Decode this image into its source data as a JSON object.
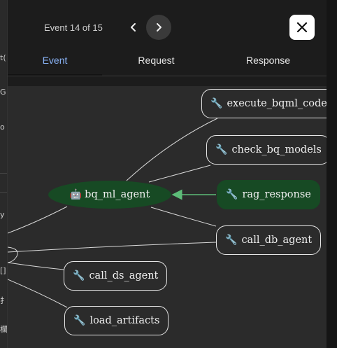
{
  "header": {
    "counter": "Event 14 of 15",
    "prev_icon": "chevron-left-icon",
    "next_icon": "chevron-right-icon",
    "close_icon": "close-icon"
  },
  "tabs": [
    {
      "label": "Event",
      "active": true
    },
    {
      "label": "Request",
      "active": false
    },
    {
      "label": "Response",
      "active": false
    }
  ],
  "underlay_fragments": [
    "t(",
    "G",
    "o",
    "y",
    "[]",
    "扌",
    "欄"
  ],
  "graph": {
    "center": {
      "label": "bq_ml_agent",
      "icon": "robot-icon"
    },
    "nodes": [
      {
        "id": "execute_bqml_code",
        "label": "execute_bqml_code",
        "icon": "wrench-icon",
        "highlighted": false
      },
      {
        "id": "check_bq_models",
        "label": "check_bq_models",
        "icon": "wrench-icon",
        "highlighted": false
      },
      {
        "id": "rag_response",
        "label": "rag_response",
        "icon": "wrench-icon",
        "highlighted": true
      },
      {
        "id": "call_db_agent",
        "label": "call_db_agent",
        "icon": "wrench-icon",
        "highlighted": false
      },
      {
        "id": "call_ds_agent",
        "label": "call_ds_agent",
        "icon": "wrench-icon",
        "highlighted": false
      },
      {
        "id": "load_artifacts",
        "label": "load_artifacts",
        "icon": "wrench-icon",
        "highlighted": false
      }
    ],
    "colors": {
      "highlight": "#174a24",
      "arrow": "#5dbb78",
      "edge": "#d8d8d8"
    }
  }
}
